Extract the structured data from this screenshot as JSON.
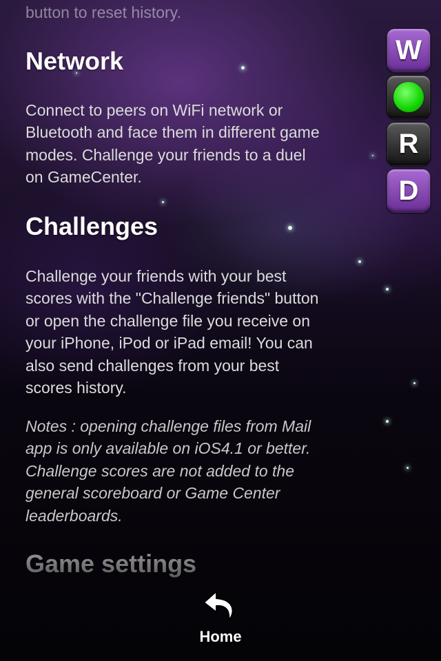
{
  "help": {
    "top_fade": "button to reset history.",
    "network": {
      "title": "Network",
      "lines": [
        "Connect to peers on WiFi network or",
        "Bluetooth and face them in different game",
        "modes. Challenge your friends to a duel",
        "on GameCenter."
      ]
    },
    "challenges": {
      "title": "Challenges",
      "lines": [
        "Challenge your friends with your best",
        "scores with the \"Challenge friends\" button",
        "or open the challenge file you receive on",
        "your iPhone, iPod or iPad email! You can",
        "also send challenges from your best",
        "scores history."
      ],
      "notes": [
        "Notes : opening challenge files from Mail",
        "app is only available on iOS4.1 or better.",
        "Challenge scores are not added to the",
        "general scoreboard or Game Center",
        "leaderboards."
      ]
    },
    "next_title": "Game settings"
  },
  "tiles": {
    "letters": [
      "W",
      "",
      "R",
      "D"
    ],
    "colors": {
      "purple": "#8a4bbd",
      "dark": "#2a2a2a",
      "green": "#11d400"
    }
  },
  "nav": {
    "home_label": "Home",
    "home_icon": "back-arrow-icon"
  }
}
